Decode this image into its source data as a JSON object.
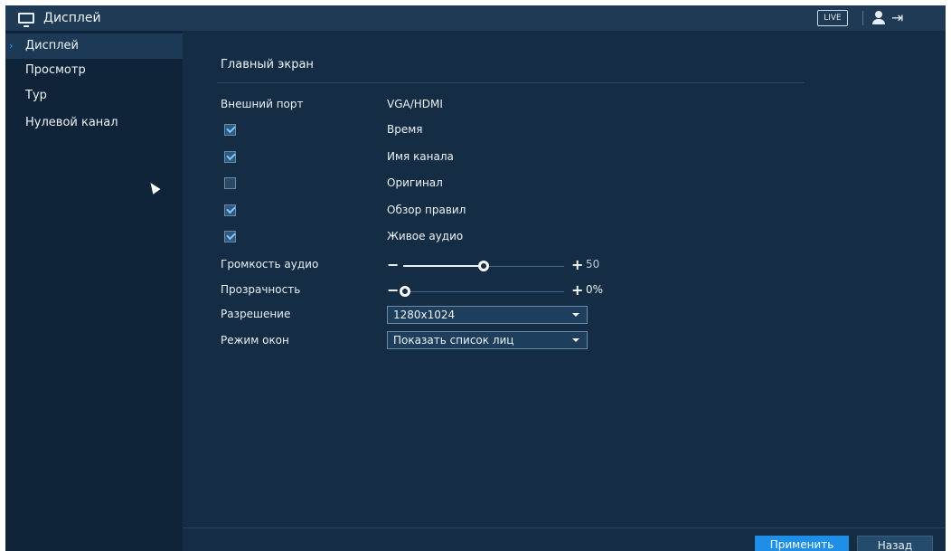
{
  "header": {
    "title": "Дисплей",
    "live_label": "LIVE",
    "icons": [
      "monitor-icon",
      "user-icon",
      "logout-icon"
    ]
  },
  "sidebar": {
    "items": [
      {
        "label": "Дисплей",
        "active": true
      },
      {
        "label": "Просмотр",
        "active": false
      },
      {
        "label": "Тур",
        "active": false
      },
      {
        "label": "Нулевой канал",
        "active": false
      }
    ]
  },
  "main": {
    "section_title": "Главный экран",
    "output_port": {
      "label": "Внешний порт",
      "value": "VGA/HDMI"
    },
    "checkboxes": [
      {
        "label": "Время",
        "checked": true
      },
      {
        "label": "Имя канала",
        "checked": true
      },
      {
        "label": "Оригинал",
        "checked": false
      },
      {
        "label": "Обзор правил",
        "checked": true
      },
      {
        "label": "Живое аудио",
        "checked": true
      }
    ],
    "volume": {
      "label": "Громкость аудио",
      "value": "50",
      "level": 0.5
    },
    "transparency": {
      "label": "Прозрачность",
      "value": "0%",
      "level": 0.0
    },
    "resolution": {
      "label": "Разрешение",
      "value": "1280x1024"
    },
    "window_mode": {
      "label": "Режим окон",
      "value": "Показать список лиц"
    },
    "buttons": {
      "apply": "Применить",
      "back": "Назад"
    }
  },
  "colors": {
    "background": "#142d45",
    "topbar": "#1e3a55",
    "sidebar": "#0f2438",
    "accent": "#1e8ee6"
  }
}
